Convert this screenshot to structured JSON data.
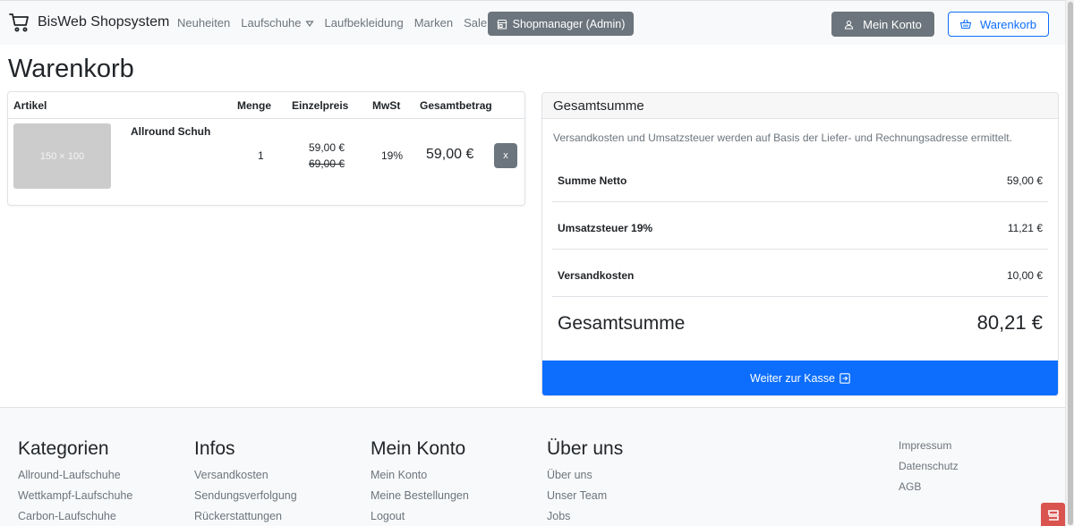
{
  "navbar": {
    "brand": "BisWeb Shopsystem",
    "links": [
      "Neuheiten",
      "Laufschuhe",
      "Laufbekleidung",
      "Marken",
      "Sale"
    ],
    "admin_button": "Shopmanager (Admin)",
    "account_button": "Mein Konto",
    "cart_button": "Warenkorb",
    "accent_color": "#0d6efd",
    "secondary_color": "#6c757d"
  },
  "page": {
    "title": "Warenkorb"
  },
  "cart": {
    "headers": {
      "artikel": "Artikel",
      "menge": "Menge",
      "einzelpreis": "Einzelpreis",
      "mwst": "MwSt",
      "gesamtbetrag": "Gesamtbetrag"
    },
    "items": [
      {
        "image_placeholder": "150 × 100",
        "name": "Allround Schuh",
        "quantity": "1",
        "price": "59,00 €",
        "old_price": "69,00 €",
        "tax": "19%",
        "total": "59,00 €",
        "remove_label": "x"
      }
    ]
  },
  "summary": {
    "title": "Gesamtsumme",
    "note": "Versandkosten und Umsatzsteuer werden auf Basis der Liefer- und Rechnungsadresse ermittelt.",
    "rows": [
      {
        "label": "Summe Netto",
        "value": "59,00 €"
      },
      {
        "label": "Umsatzsteuer 19%",
        "value": "11,21 €"
      },
      {
        "label": "Versandkosten",
        "value": "10,00 €"
      }
    ],
    "grand_total_label": "Gesamtsumme",
    "grand_total_value": "80,21 €",
    "checkout_button": "Weiter zur Kasse"
  },
  "footer": {
    "columns": [
      {
        "title": "Kategorien",
        "links": [
          "Allround-Laufschuhe",
          "Wettkampf-Laufschuhe",
          "Carbon-Laufschuhe"
        ]
      },
      {
        "title": "Infos",
        "links": [
          "Versandkosten",
          "Sendungsverfolgung",
          "Rückerstattungen"
        ]
      },
      {
        "title": "Mein Konto",
        "links": [
          "Mein Konto",
          "Meine Bestellungen",
          "Logout"
        ]
      },
      {
        "title": "Über uns",
        "links": [
          "Über uns",
          "Unser Team",
          "Jobs"
        ]
      }
    ],
    "legal_links": [
      "Impressum",
      "Datenschutz",
      "AGB"
    ]
  }
}
